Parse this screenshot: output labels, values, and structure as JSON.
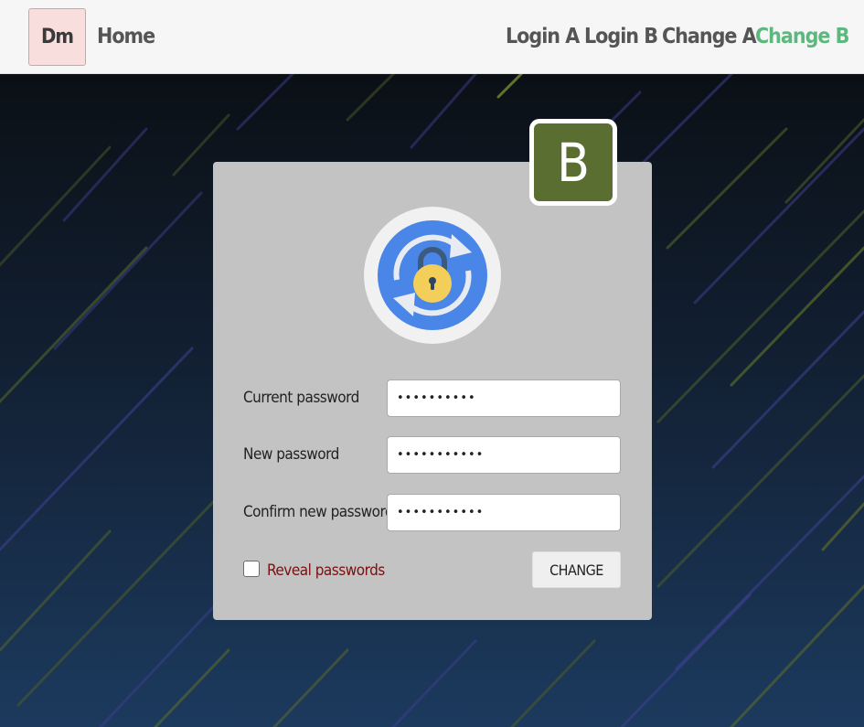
{
  "navbar": {
    "brand": "Dm",
    "home": "Home",
    "links": [
      {
        "label": "Login A",
        "active": false
      },
      {
        "label": "Login B",
        "active": false
      },
      {
        "label": "Change A",
        "active": false
      },
      {
        "label": "Change B",
        "active": true
      }
    ],
    "active_color": "#5cb87f"
  },
  "badge": "B",
  "form": {
    "current_password": {
      "label": "Current password",
      "value": "••••••••••"
    },
    "new_password": {
      "label": "New password",
      "value": "•••••••••••"
    },
    "confirm_password": {
      "label": "Confirm new password",
      "value": "•••••••••••"
    },
    "reveal": {
      "label": "Reveal passwords",
      "checked": false
    },
    "submit": "CHANGE"
  },
  "colors": {
    "badge_bg": "#5a6e31",
    "card_bg": "#c3c3c3",
    "reveal_text": "#7a1010"
  },
  "icons": {
    "lock": "lock-refresh-icon"
  }
}
